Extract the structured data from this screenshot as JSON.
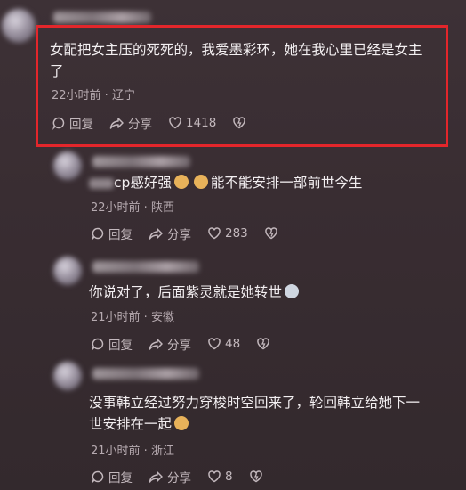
{
  "comments": [
    {
      "text_line1": "女配把女主压的死死的，我爱墨彩环，她在我心里已经是女主",
      "text_line2": "了",
      "meta": "22小时前 · 辽宁",
      "reply_label": "回复",
      "share_label": "分享",
      "likes": "1418"
    },
    {
      "text_prefix": "cp感好强",
      "text_suffix": "能不能安排一部前世今生",
      "meta": "22小时前 · 陕西",
      "reply_label": "回复",
      "share_label": "分享",
      "likes": "283"
    },
    {
      "text": "你说对了，后面紫灵就是她转世",
      "meta": "21小时前 · 安徽",
      "reply_label": "回复",
      "share_label": "分享",
      "likes": "48"
    },
    {
      "text_line1": "没事韩立经过努力穿梭时空回来了，轮回韩立给她下一",
      "text_line2": "世安排在一起",
      "meta": "21小时前 · 浙江",
      "reply_label": "回复",
      "share_label": "分享",
      "likes": "8"
    }
  ],
  "colors": {
    "highlight": "#e3262b",
    "background": "#3a2e33"
  },
  "icons": [
    "reply-icon",
    "share-icon",
    "heart-icon",
    "dislike-icon"
  ]
}
